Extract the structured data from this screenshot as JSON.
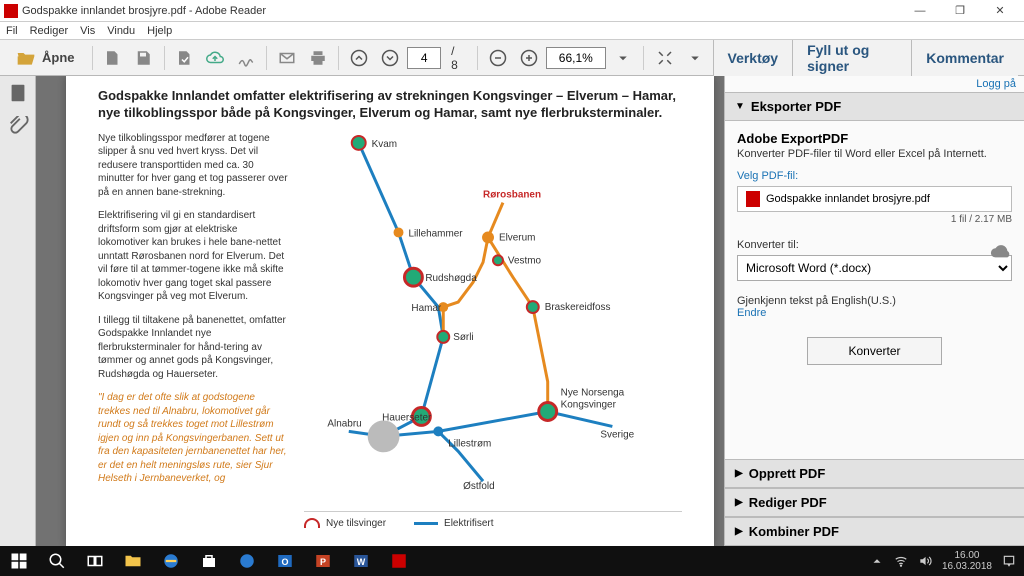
{
  "window": {
    "title": "Godspakke innlandet brosjyre.pdf - Adobe Reader"
  },
  "menu": {
    "file": "Fil",
    "edit": "Rediger",
    "view": "Vis",
    "window": "Vindu",
    "help": "Hjelp"
  },
  "toolbar": {
    "open": "Åpne",
    "page_current": "4",
    "page_total": "/ 8",
    "zoom": "66,1%",
    "tools": "Verktøy",
    "fillSign": "Fyll ut og signer",
    "comment": "Kommentar"
  },
  "login": "Logg på",
  "doc": {
    "heading": "Godspakke Innlandet omfatter elektrifisering av strekningen Kongsvinger – Elverum – Hamar, nye tilkoblingsspor både på Kongsvinger, Elverum og Hamar, samt nye flerbruksterminaler.",
    "p1": "Nye tilkoblingsspor medfører at togene slipper å snu ved hvert kryss. Det vil redusere transporttiden med ca. 30 minutter for hver gang et tog passerer over på en annen bane-strekning.",
    "p2": "Elektrifisering vil gi en standardisert driftsform som gjør at elektriske lokomotiver kan brukes i hele bane-nettet unntatt Rørosbanen nord for Elverum. Det vil føre til at tømmer-togene ikke må skifte lokomotiv hver gang toget skal passere Kongsvinger på veg mot Elverum.",
    "p3": "I tillegg til tiltakene på banenettet, omfatter Godspakke Innlandet nye flerbruksterminaler for hånd-tering av tømmer og annet gods på Kongsvinger, Rudshøgda og Hauerseter.",
    "p4": "\"I dag er det ofte slik at godstogene trekkes ned til Alnabru, lokomotivet går rundt og så trekkes toget mot Lillestrøm igjen og inn på Kongsvingerbanen. Sett ut fra den kapasiteten jernbanenettet har her, er det en helt meningsløs rute, sier Sjur Helseth i Jernbaneverket, og",
    "map": {
      "kvam": "Kvam",
      "lillehammer": "Lillehammer",
      "rudshogda": "Rudshøgda",
      "hamar": "Hamar",
      "sorli": "Sørli",
      "rorosbanen": "Rørosbanen",
      "elverum": "Elverum",
      "vestmo": "Vestmo",
      "braskereidfoss": "Braskereidfoss",
      "nyenorsenga": "Nye Norsenga",
      "kongsvinger": "Kongsvinger",
      "sverige": "Sverige",
      "hauerseter": "Hauerseter",
      "alnabru": "Alnabru",
      "lillestrom": "Lillestrøm",
      "ostfold": "Østfold"
    },
    "legend": {
      "new": "Nye tilsvinger",
      "elec": "Elektrifisert"
    }
  },
  "panel": {
    "export_hd": "Eksporter PDF",
    "brand": "Adobe ExportPDF",
    "sub": "Konverter PDF-filer til Word eller Excel på Internett.",
    "select_label": "Velg PDF-fil:",
    "file": "Godspakke innlandet brosjyre.pdf",
    "file_meta": "1 fil / 2.17 MB",
    "convert_to": "Konverter til:",
    "format": "Microsoft Word (*.docx)",
    "ocr_text": "Gjenkjenn tekst på English(U.S.)",
    "ocr_change": "Endre",
    "convert_btn": "Konverter",
    "create": "Opprett PDF",
    "edit": "Rediger PDF",
    "combine": "Kombiner PDF"
  },
  "taskbar": {
    "time": "16.00",
    "date": "16.03.2018"
  }
}
